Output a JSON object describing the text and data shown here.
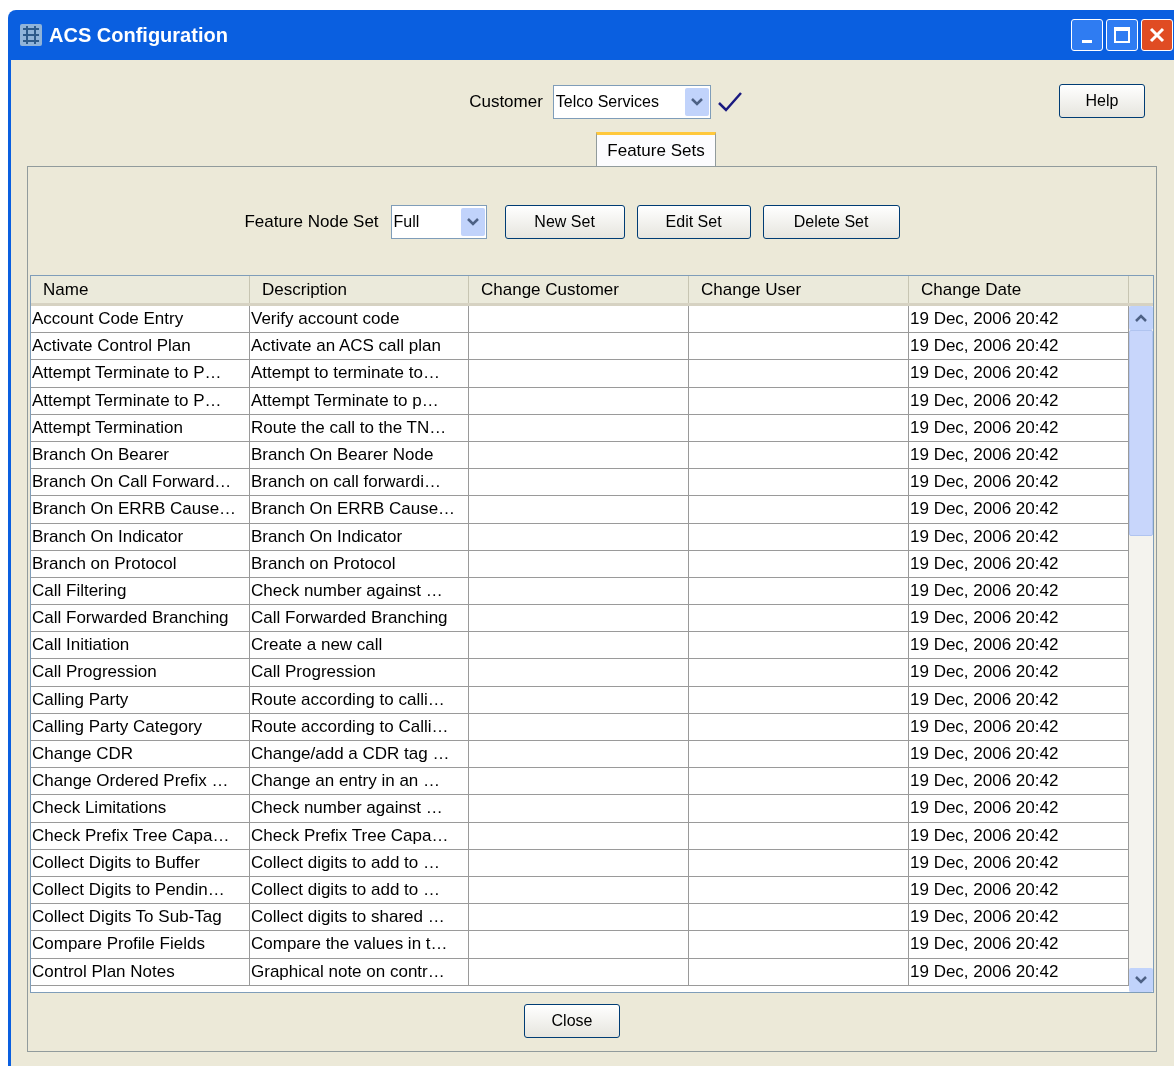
{
  "window": {
    "title": "ACS Configuration"
  },
  "customer": {
    "label": "Customer",
    "value": "Telco Services"
  },
  "help_button": "Help",
  "tabs": [
    {
      "label": "Feature Sets",
      "selected": true
    }
  ],
  "feature_node_set": {
    "label": "Feature Node Set",
    "value": "Full"
  },
  "buttons": [
    "New Set",
    "Edit Set",
    "Delete Set"
  ],
  "table": {
    "columns": [
      "Name",
      "Description",
      "Change Customer",
      "Change User",
      "Change Date"
    ],
    "rows": [
      {
        "name": "Account Code Entry",
        "description": "Verify account code",
        "change_date": "19 Dec, 2006 20:42"
      },
      {
        "name": "Activate Control Plan",
        "description": "Activate an ACS call plan",
        "change_date": "19 Dec, 2006 20:42"
      },
      {
        "name": "Attempt Terminate to P…",
        "description": "Attempt to terminate to…",
        "change_date": "19 Dec, 2006 20:42"
      },
      {
        "name": "Attempt Terminate to P…",
        "description": "Attempt Terminate to p…",
        "change_date": "19 Dec, 2006 20:42"
      },
      {
        "name": "Attempt Termination",
        "description": "Route the call to the TN…",
        "change_date": "19 Dec, 2006 20:42"
      },
      {
        "name": "Branch On Bearer",
        "description": "Branch On Bearer Node",
        "change_date": "19 Dec, 2006 20:42"
      },
      {
        "name": "Branch On Call Forward…",
        "description": "Branch on call forwardi…",
        "change_date": "19 Dec, 2006 20:42"
      },
      {
        "name": "Branch On ERRB Cause…",
        "description": "Branch On ERRB Cause…",
        "change_date": "19 Dec, 2006 20:42"
      },
      {
        "name": "Branch On Indicator",
        "description": "Branch On Indicator",
        "change_date": "19 Dec, 2006 20:42"
      },
      {
        "name": "Branch on Protocol",
        "description": "Branch on Protocol",
        "change_date": "19 Dec, 2006 20:42"
      },
      {
        "name": "Call Filtering",
        "description": "Check number against …",
        "change_date": "19 Dec, 2006 20:42"
      },
      {
        "name": "Call Forwarded Branching",
        "description": "Call Forwarded Branching",
        "change_date": "19 Dec, 2006 20:42"
      },
      {
        "name": "Call Initiation",
        "description": "Create a new call",
        "change_date": "19 Dec, 2006 20:42"
      },
      {
        "name": "Call Progression",
        "description": "Call Progression",
        "change_date": "19 Dec, 2006 20:42"
      },
      {
        "name": "Calling Party",
        "description": "Route according to calli…",
        "change_date": "19 Dec, 2006 20:42"
      },
      {
        "name": "Calling Party Category",
        "description": "Route according to Calli…",
        "change_date": "19 Dec, 2006 20:42"
      },
      {
        "name": "Change CDR",
        "description": "Change/add a CDR tag …",
        "change_date": "19 Dec, 2006 20:42"
      },
      {
        "name": "Change Ordered Prefix …",
        "description": "Change an entry in an …",
        "change_date": "19 Dec, 2006 20:42"
      },
      {
        "name": "Check Limitations",
        "description": "Check number against …",
        "change_date": "19 Dec, 2006 20:42"
      },
      {
        "name": "Check Prefix Tree Capa…",
        "description": "Check Prefix Tree Capa…",
        "change_date": "19 Dec, 2006 20:42"
      },
      {
        "name": "Collect Digits to Buffer",
        "description": "Collect digits to add to …",
        "change_date": "19 Dec, 2006 20:42"
      },
      {
        "name": "Collect Digits to Pendin…",
        "description": "Collect digits to add to …",
        "change_date": "19 Dec, 2006 20:42"
      },
      {
        "name": "Collect Digits To Sub-Tag",
        "description": "Collect digits to shared …",
        "change_date": "19 Dec, 2006 20:42"
      },
      {
        "name": "Compare Profile Fields",
        "description": "Compare the values in t…",
        "change_date": "19 Dec, 2006 20:42"
      },
      {
        "name": "Control Plan Notes",
        "description": "Graphical note on contr…",
        "change_date": "19 Dec, 2006 20:42"
      }
    ]
  },
  "close_button": "Close"
}
